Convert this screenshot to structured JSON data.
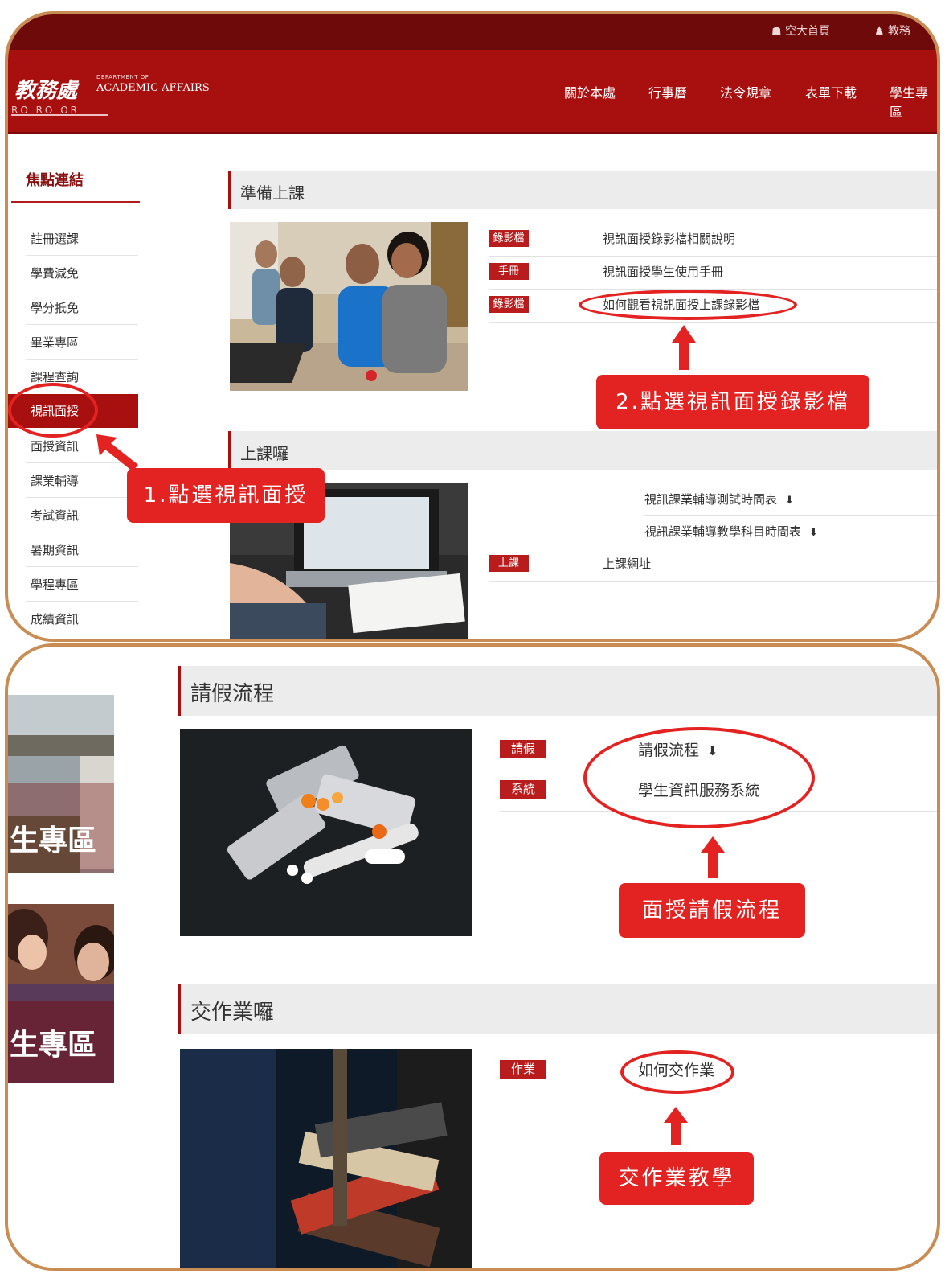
{
  "top": {
    "util": {
      "home": "☗ 空大首頁",
      "login": "♟ 教務"
    },
    "logo": {
      "zh": "教務處",
      "en_small": "DEPARTMENT OF",
      "en": "ACADEMIC AFFAIRS",
      "bar": "RO RO OR"
    },
    "nav": [
      "關於本處",
      "行事曆",
      "法令規章",
      "表單下載",
      "學生專區"
    ],
    "sidebar": {
      "title": "焦點連結",
      "items": [
        "註冊選課",
        "學費減免",
        "學分抵免",
        "畢業專區",
        "課程查詢",
        "視訊面授",
        "面授資訊",
        "課業輔導",
        "考試資訊",
        "暑期資訊",
        "學程專區",
        "成績資訊"
      ]
    },
    "sections": {
      "prepare": {
        "title": "準備上課",
        "rows": [
          {
            "tag": "錄影檔",
            "link": "視訊面授錄影檔相關說明"
          },
          {
            "tag": "手冊",
            "link": "視訊面授學生使用手冊"
          },
          {
            "tag": "錄影檔",
            "link": "如何觀看視訊面授上課錄影檔"
          }
        ]
      },
      "class": {
        "title": "上課囉",
        "links": [
          "視訊課業輔導測試時間表",
          "視訊課業輔導教學科目時間表"
        ],
        "tag": "上課",
        "link": "上課網址",
        "download_icon": "download-icon"
      }
    },
    "annotations": {
      "step1": "1.點選視訊面授",
      "step2": "2.點選視訊面授錄影檔"
    }
  },
  "bottom": {
    "banner_left": [
      "生專區",
      "生專區"
    ],
    "sections": {
      "leave": {
        "title": "請假流程",
        "rows": [
          {
            "tag": "請假",
            "link": "請假流程"
          },
          {
            "tag": "系統",
            "link": "學生資訊服務系統"
          }
        ]
      },
      "homework": {
        "title": "交作業囉",
        "rows": [
          {
            "tag": "作業",
            "link": "如何交作業"
          }
        ]
      }
    },
    "annotations": {
      "leave": "面授請假流程",
      "homework": "交作業教學"
    }
  },
  "colors": {
    "brand_red": "#a81010",
    "dark_red": "#6e0a0a",
    "annotation_red": "#e32222",
    "frame": "#c98c52"
  }
}
